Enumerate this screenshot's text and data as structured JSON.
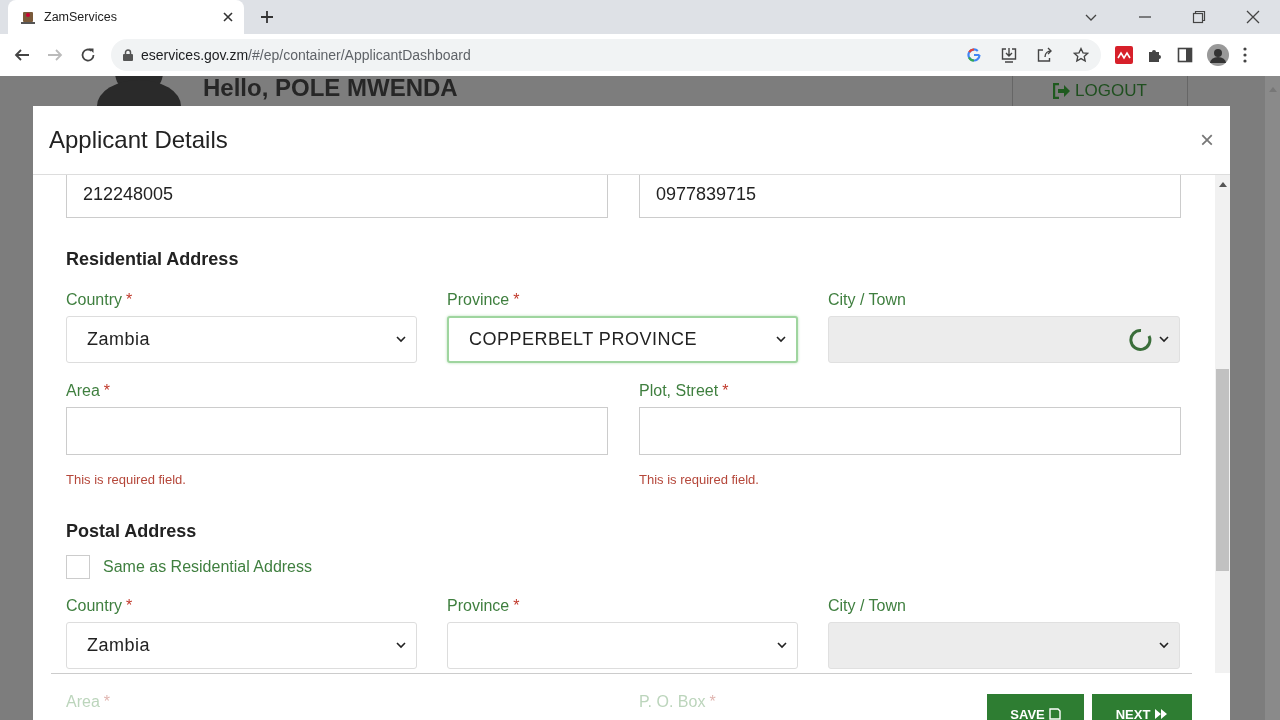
{
  "browser": {
    "tab_title": "ZamServices",
    "url_host": "eservices.gov.zm",
    "url_path": "/#/ep/container/ApplicantDashboard"
  },
  "background": {
    "greeting": "Hello, POLE MWENDA",
    "logout": "LOGOUT"
  },
  "modal": {
    "title": "Applicant Details",
    "close": "×",
    "top_fields": [
      {
        "value": "212248005"
      },
      {
        "value": "0977839715"
      }
    ],
    "sections": [
      {
        "heading": "Residential Address",
        "selects": [
          {
            "label": "Country",
            "mark": "*",
            "value": "Zambia",
            "focused": false
          },
          {
            "label": "Province",
            "mark": "*",
            "value": "COPPERBELT PROVINCE",
            "focused": true
          },
          {
            "label": "City / Town",
            "disabled": true,
            "focused": false,
            "loading": true
          }
        ],
        "inputs": [
          {
            "label": "Area",
            "mark": "*",
            "error": "This is required field."
          },
          {
            "label": "Plot, Street",
            "mark": "*",
            "error": "This is required field."
          }
        ]
      },
      {
        "heading": "Postal Address",
        "checkbox": {
          "label": "Same as Residential Address",
          "checked": false
        },
        "selects": [
          {
            "label": "Country",
            "mark": "*",
            "value": "Zambia",
            "focused": false
          },
          {
            "label": "Province",
            "mark": "*",
            "focused": false
          },
          {
            "label": "City / Town",
            "disabled": true,
            "focused": false
          }
        ]
      }
    ],
    "faded_labels": [
      {
        "label": "Area",
        "mark": "*"
      },
      {
        "label": "P. O. Box",
        "mark": "*"
      }
    ],
    "buttons": [
      {
        "label": "SAVE",
        "kind": "save"
      },
      {
        "label": "NEXT",
        "kind": "next"
      }
    ]
  }
}
